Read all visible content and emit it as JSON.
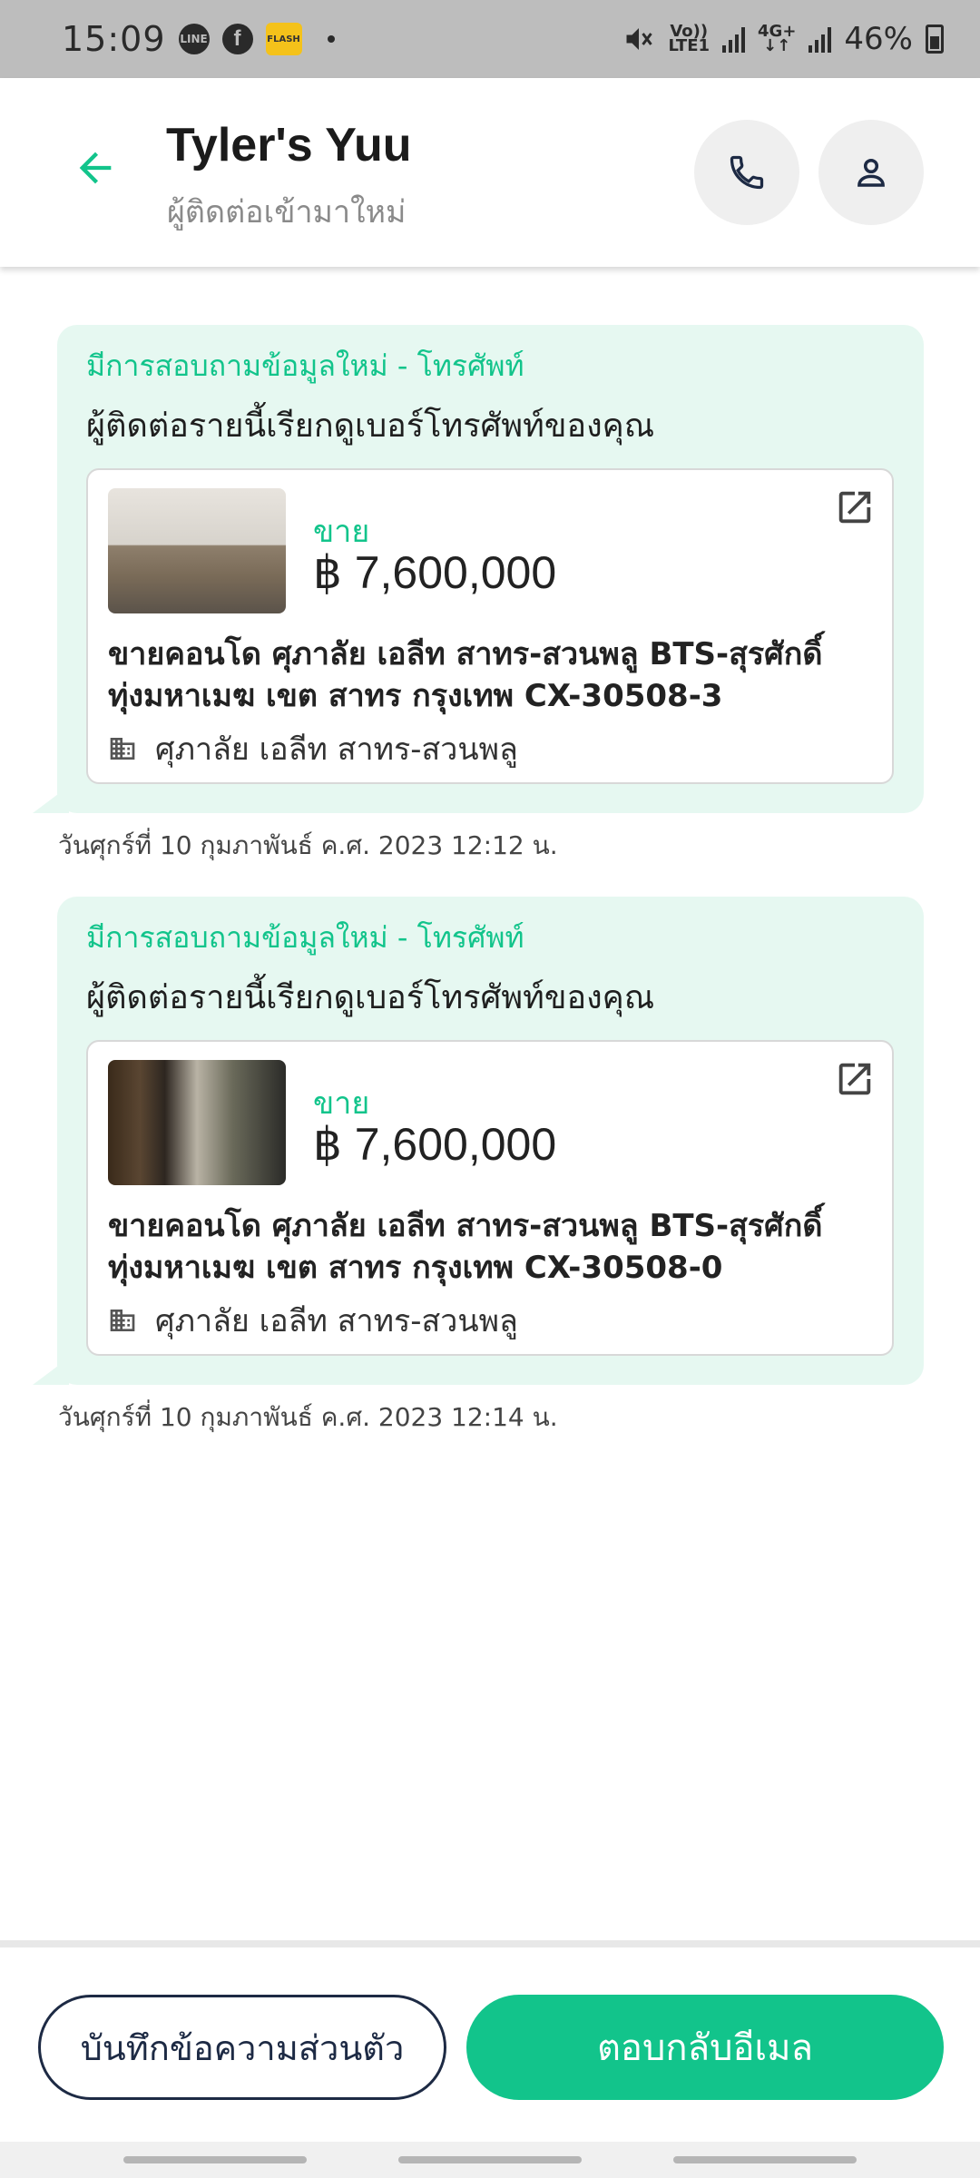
{
  "status_bar": {
    "time": "15:09",
    "notif_icons": [
      "line-icon",
      "facebook-icon",
      "app-icon"
    ],
    "line_label": "LINE",
    "facebook_label": "f",
    "app_label": "FLASH",
    "volte_top": "Vo))",
    "volte_bottom": "LTE1",
    "net_top": "4G+",
    "net_bottom": "↓↑",
    "battery": "46%"
  },
  "header": {
    "title": "Tyler's Yuu",
    "subtitle": "ผู้ติดต่อเข้ามาใหม่"
  },
  "messages": [
    {
      "label": "มีการสอบถามข้อมูลใหม่ - โทรศัพท์",
      "text": "ผู้ติดต่อรายนี้เรียกดูเบอร์โทรศัพท์ของคุณ",
      "listing": {
        "type": "ขาย",
        "price": "฿ 7,600,000",
        "title": "ขายคอนโด  ศุภาลัย เอลีท สาทร-สวนพลู BTS-สุรศักดิ์ ทุ่งมหาเมฆ เขต สาทร กรุงเทพ CX-30508-3",
        "building": "ศุภาลัย เอลีท สาทร-สวนพลู"
      },
      "time": "วันศุกร์ที่ 10 กุมภาพันธ์ ค.ศ. 2023 12:12 น."
    },
    {
      "label": "มีการสอบถามข้อมูลใหม่ - โทรศัพท์",
      "text": "ผู้ติดต่อรายนี้เรียกดูเบอร์โทรศัพท์ของคุณ",
      "listing": {
        "type": "ขาย",
        "price": "฿ 7,600,000",
        "title": "ขายคอนโด  ศุภาลัย เอลีท สาทร-สวนพลู BTS-สุรศักดิ์ ทุ่งมหาเมฆ เขต สาทร กรุงเทพ CX-30508-0",
        "building": "ศุภาลัย เอลีท สาทร-สวนพลู"
      },
      "time": "วันศุกร์ที่ 10 กุมภาพันธ์ ค.ศ. 2023 12:14 น."
    }
  ],
  "actions": {
    "note_label": "บันทึกข้อความส่วนตัว",
    "reply_label": "ตอบกลับอีเมล"
  },
  "colors": {
    "accent": "#12c48b",
    "bubble": "#e6f8f1",
    "navy": "#1d2a44"
  }
}
